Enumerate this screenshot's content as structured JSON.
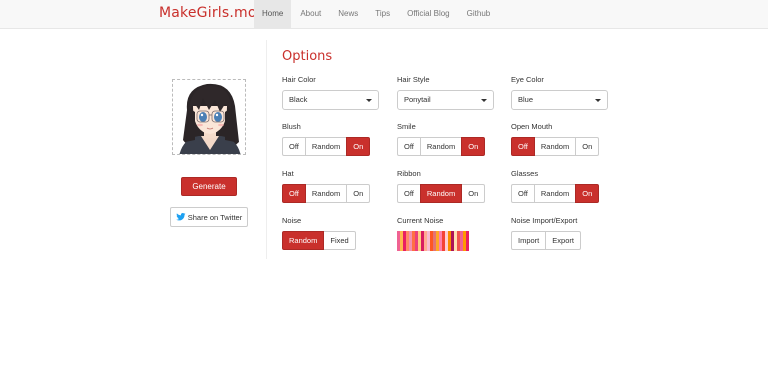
{
  "navbar": {
    "brand": "MakeGirls.moe",
    "items": [
      "Home",
      "About",
      "News",
      "Tips",
      "Official Blog",
      "Github"
    ],
    "active_index": 0
  },
  "left": {
    "generate_label": "Generate",
    "twitter_label": "Share on Twitter"
  },
  "options": {
    "title": "Options",
    "hair_color": {
      "label": "Hair Color",
      "value": "Black"
    },
    "hair_style": {
      "label": "Hair Style",
      "value": "Ponytail"
    },
    "eye_color": {
      "label": "Eye Color",
      "value": "Blue"
    },
    "blush": {
      "label": "Blush",
      "buttons": [
        "Off",
        "Random",
        "On"
      ],
      "selected": "On"
    },
    "smile": {
      "label": "Smile",
      "buttons": [
        "Off",
        "Random",
        "On"
      ],
      "selected": "On"
    },
    "open_mouth": {
      "label": "Open Mouth",
      "buttons": [
        "Off",
        "Random",
        "On"
      ],
      "selected": "Off"
    },
    "hat": {
      "label": "Hat",
      "buttons": [
        "Off",
        "Random",
        "On"
      ],
      "selected": "Off"
    },
    "ribbon": {
      "label": "Ribbon",
      "buttons": [
        "Off",
        "Random",
        "On"
      ],
      "selected": "Random"
    },
    "glasses": {
      "label": "Glasses",
      "buttons": [
        "Off",
        "Random",
        "On"
      ],
      "selected": "On"
    },
    "noise": {
      "label": "Noise",
      "buttons": [
        "Random",
        "Fixed"
      ],
      "selected": "Random"
    },
    "current_noise": {
      "label": "Current Noise"
    },
    "noise_io": {
      "label": "Noise Import/Export",
      "buttons": [
        "Import",
        "Export"
      ]
    }
  },
  "colors": {
    "accent": "#c9302c",
    "noise_stripes": [
      "#f06292",
      "#ffb74d",
      "#e91e63",
      "#ff8a65",
      "#f48fb1",
      "#ff7043",
      "#ec407a",
      "#ffcc80",
      "#d81b60",
      "#ffab91",
      "#f8bbd0",
      "#ff5722",
      "#e57373",
      "#ffa726",
      "#ff80ab",
      "#f44336",
      "#ffcdd2",
      "#fb8c00",
      "#ad1457",
      "#ffe0b2",
      "#ef5350",
      "#f06292",
      "#ff9800",
      "#e91e63"
    ]
  }
}
